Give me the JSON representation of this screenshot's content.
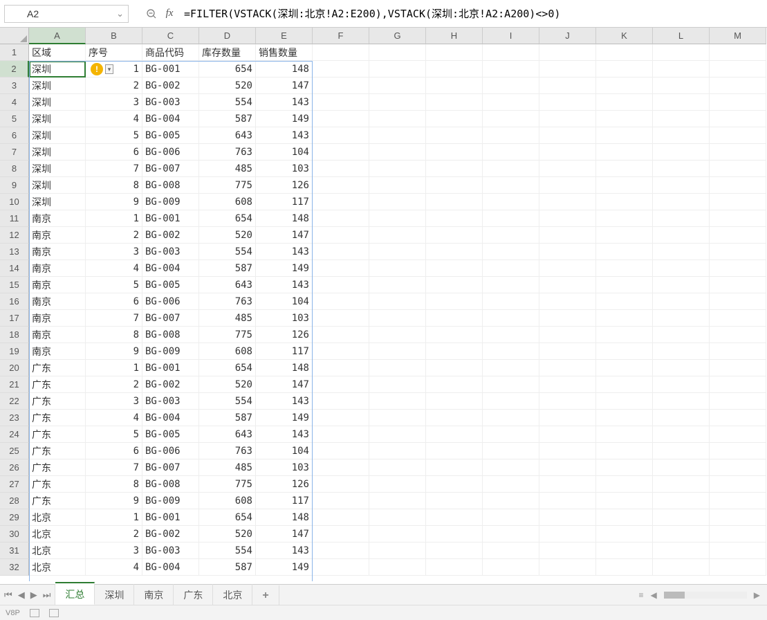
{
  "nameBox": "A2",
  "formula": "=FILTER(VSTACK(深圳:北京!A2:E200),VSTACK(深圳:北京!A2:A200)<>0)",
  "columns": [
    "A",
    "B",
    "C",
    "D",
    "E",
    "F",
    "G",
    "H",
    "I",
    "J",
    "K",
    "L",
    "M"
  ],
  "selectedCol": "A",
  "selectedRow": 2,
  "headers": [
    "区域",
    "序号",
    "商品代码",
    "库存数量",
    "销售数量"
  ],
  "tabs": [
    {
      "label": "汇总",
      "active": true
    },
    {
      "label": "深圳",
      "active": false
    },
    {
      "label": "南京",
      "active": false
    },
    {
      "label": "广东",
      "active": false
    },
    {
      "label": "北京",
      "active": false
    }
  ],
  "regions": [
    "深圳",
    "南京",
    "广东",
    "北京"
  ],
  "baseRows": [
    {
      "seq": 1,
      "code": "BG-001",
      "stock": 654,
      "sales": 148
    },
    {
      "seq": 2,
      "code": "BG-002",
      "stock": 520,
      "sales": 147
    },
    {
      "seq": 3,
      "code": "BG-003",
      "stock": 554,
      "sales": 143
    },
    {
      "seq": 4,
      "code": "BG-004",
      "stock": 587,
      "sales": 149
    },
    {
      "seq": 5,
      "code": "BG-005",
      "stock": 643,
      "sales": 143
    },
    {
      "seq": 6,
      "code": "BG-006",
      "stock": 763,
      "sales": 104
    },
    {
      "seq": 7,
      "code": "BG-007",
      "stock": 485,
      "sales": 103
    },
    {
      "seq": 8,
      "code": "BG-008",
      "stock": 775,
      "sales": 126
    },
    {
      "seq": 9,
      "code": "BG-009",
      "stock": 608,
      "sales": 117
    }
  ],
  "visibleRowCount": 32,
  "errorGlyph": "!",
  "fxLabel": "fx",
  "addTabLabel": "+",
  "statusLabel": "V8P"
}
